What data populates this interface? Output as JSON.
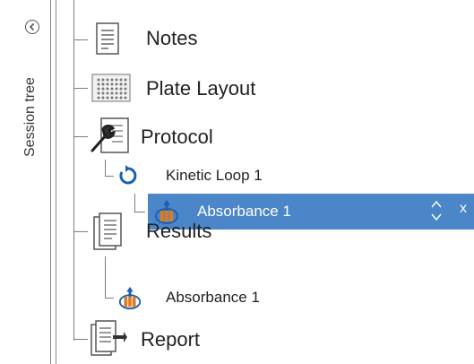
{
  "sidebar": {
    "title": "Session tree",
    "collapse_icon": "chevron-left-icon"
  },
  "tree": {
    "items": [
      {
        "label": "Notes",
        "icon": "notes-icon"
      },
      {
        "label": "Plate Layout",
        "icon": "plate-grid-icon"
      },
      {
        "label": "Protocol",
        "icon": "wrench-document-icon"
      },
      {
        "label": "Kinetic Loop 1",
        "icon": "loop-icon"
      },
      {
        "label": "Absorbance 1",
        "icon": "absorbance-icon",
        "selected": true
      },
      {
        "label": "Results",
        "icon": "results-icon"
      },
      {
        "label": "Absorbance 1",
        "icon": "absorbance-icon"
      },
      {
        "label": "Report",
        "icon": "report-icon"
      }
    ],
    "selected_controls": {
      "reorder_icon": "up-down-chevron-icon",
      "remove_label": "x"
    }
  },
  "colors": {
    "selection": "#4a86c8",
    "loop_blue": "#1a5fb0"
  }
}
